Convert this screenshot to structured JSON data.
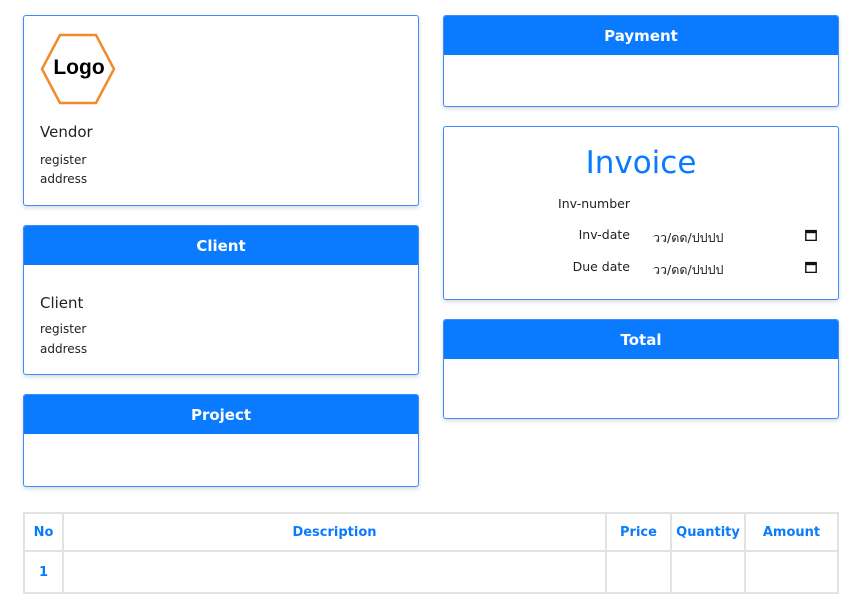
{
  "vendor": {
    "logo_text": "Logo",
    "name": "Vendor",
    "register": "register",
    "address": "address"
  },
  "payment": {
    "header": "Payment"
  },
  "client": {
    "header": "Client",
    "name": "Client",
    "register": "register",
    "address": "address"
  },
  "invoice": {
    "title": "Invoice",
    "number_label": "Inv-number",
    "date_label": "Inv-date",
    "date_placeholder": "วว/ดด/ปปปป",
    "due_label": "Due date",
    "due_placeholder": "วว/ดด/ปปปป"
  },
  "project": {
    "header": "Project"
  },
  "total": {
    "header": "Total"
  },
  "table": {
    "headers": [
      "No",
      "Description",
      "Price",
      "Quantity",
      "Amount"
    ],
    "rows": [
      [
        "1",
        "",
        "",
        "",
        ""
      ]
    ]
  },
  "colors": {
    "accent": "#0a7bff",
    "logo_hexagon": "#f08a2c",
    "card_border": "#3d8bff"
  }
}
